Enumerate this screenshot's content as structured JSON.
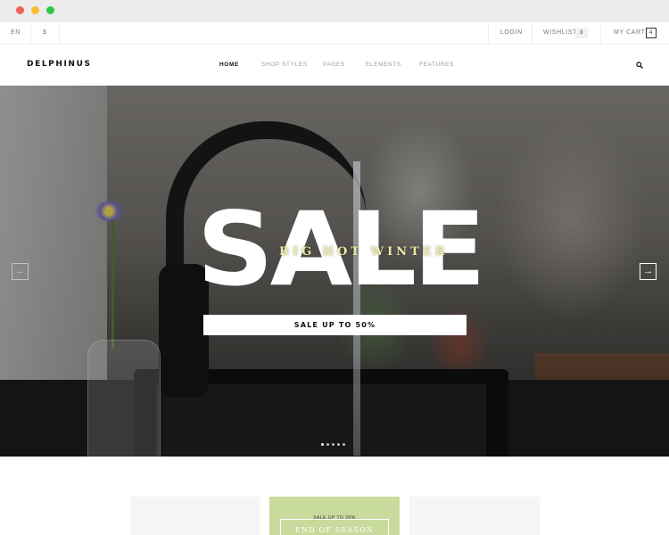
{
  "topbar": {
    "language": "EN",
    "currency": "$",
    "login": "LOGIN",
    "wishlist": "WISHLIST",
    "wishlist_count": "3",
    "cart": "MY CART",
    "cart_count": "4"
  },
  "nav": {
    "logo": "DELPHINUS",
    "items": [
      {
        "label": "HOME",
        "active": true
      },
      {
        "label": "SHOP STYLES",
        "active": false
      },
      {
        "label": "PAGES",
        "active": false
      },
      {
        "label": "ELEMENTS",
        "active": false
      },
      {
        "label": "FEATURES",
        "active": false
      }
    ],
    "search_icon": "search-icon"
  },
  "hero": {
    "headline": "SALE",
    "subtitle": "BIG HOT WINTER",
    "cta": "SALE UP TO 50%",
    "prev_arrow": "←",
    "next_arrow": "→",
    "slide_count": 5,
    "active_slide": 1
  },
  "promos": {
    "middle": {
      "small": "SALE UP TO 30%",
      "big": "END OF SEASON"
    }
  },
  "colors": {
    "promo_green": "#c9db9c",
    "subtitle_yellow": "#e8eaa2"
  }
}
